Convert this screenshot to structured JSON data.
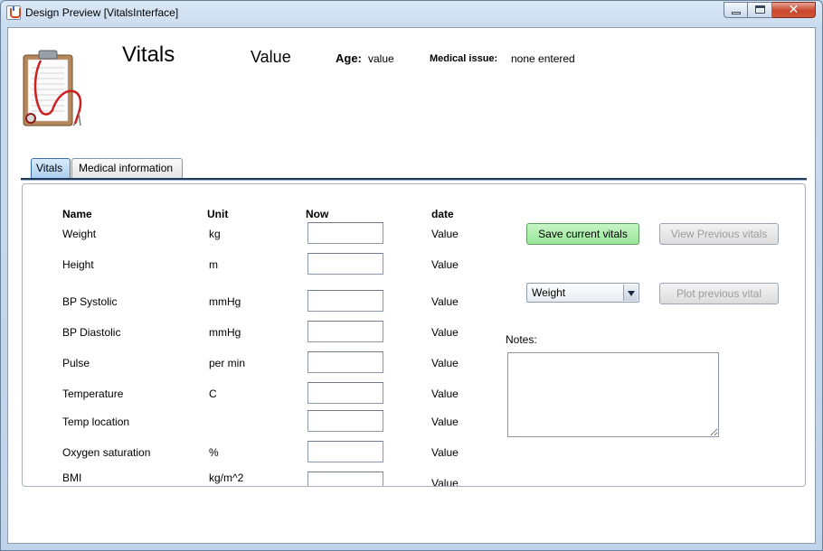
{
  "window": {
    "title": "Design Preview [VitalsInterface]",
    "controls": [
      "minimize-icon",
      "maximize-icon",
      "close-icon"
    ],
    "close_glyph": "✕"
  },
  "header": {
    "title": "Vitals",
    "patient_name": "Value",
    "age_label": "Age:",
    "age_value": "value",
    "medical_issue_label": "Medical issue:",
    "medical_issue_value": "none entered",
    "logo_icon": "clipboard-stethoscope-icon"
  },
  "tabs": [
    {
      "label": "Vitals",
      "selected": true
    },
    {
      "label": "Medical information",
      "selected": false
    }
  ],
  "vitals": {
    "columns": {
      "name": "Name",
      "unit": "Unit",
      "now": "Now",
      "date": "date"
    },
    "rows": [
      {
        "name": "Weight",
        "unit": "kg",
        "now": "",
        "date": "Value"
      },
      {
        "name": "Height",
        "unit": " m",
        "now": "",
        "date": "Value"
      },
      {
        "name": "BP Systolic",
        "unit": "mmHg",
        "now": "",
        "date": "Value"
      },
      {
        "name": "BP Diastolic",
        "unit": "mmHg",
        "now": "",
        "date": "Value"
      },
      {
        "name": "Pulse",
        "unit": "per min",
        "now": "",
        "date": "Value"
      },
      {
        "name": "Temperature",
        "unit": "C",
        "now": "",
        "date": "Value"
      },
      {
        "name": "Temp location",
        "unit": "",
        "now": "",
        "date": "Value"
      },
      {
        "name": "Oxygen saturation",
        "unit": "%",
        "now": "",
        "date": "Value"
      },
      {
        "name": "BMI",
        "unit": "kg/m^2",
        "now": "",
        "date": "Value"
      }
    ]
  },
  "actions": {
    "save_label": "Save current vitals",
    "view_previous_label": "View Previous vitals",
    "plot_select_value": "Weight",
    "plot_previous_label": "Plot previous vital",
    "notes_label": "Notes:",
    "notes_value": ""
  },
  "colors": {
    "save_button": "#98e698",
    "selected_tab": "#a9cdef",
    "disabled_text": "#9c9c9c"
  }
}
